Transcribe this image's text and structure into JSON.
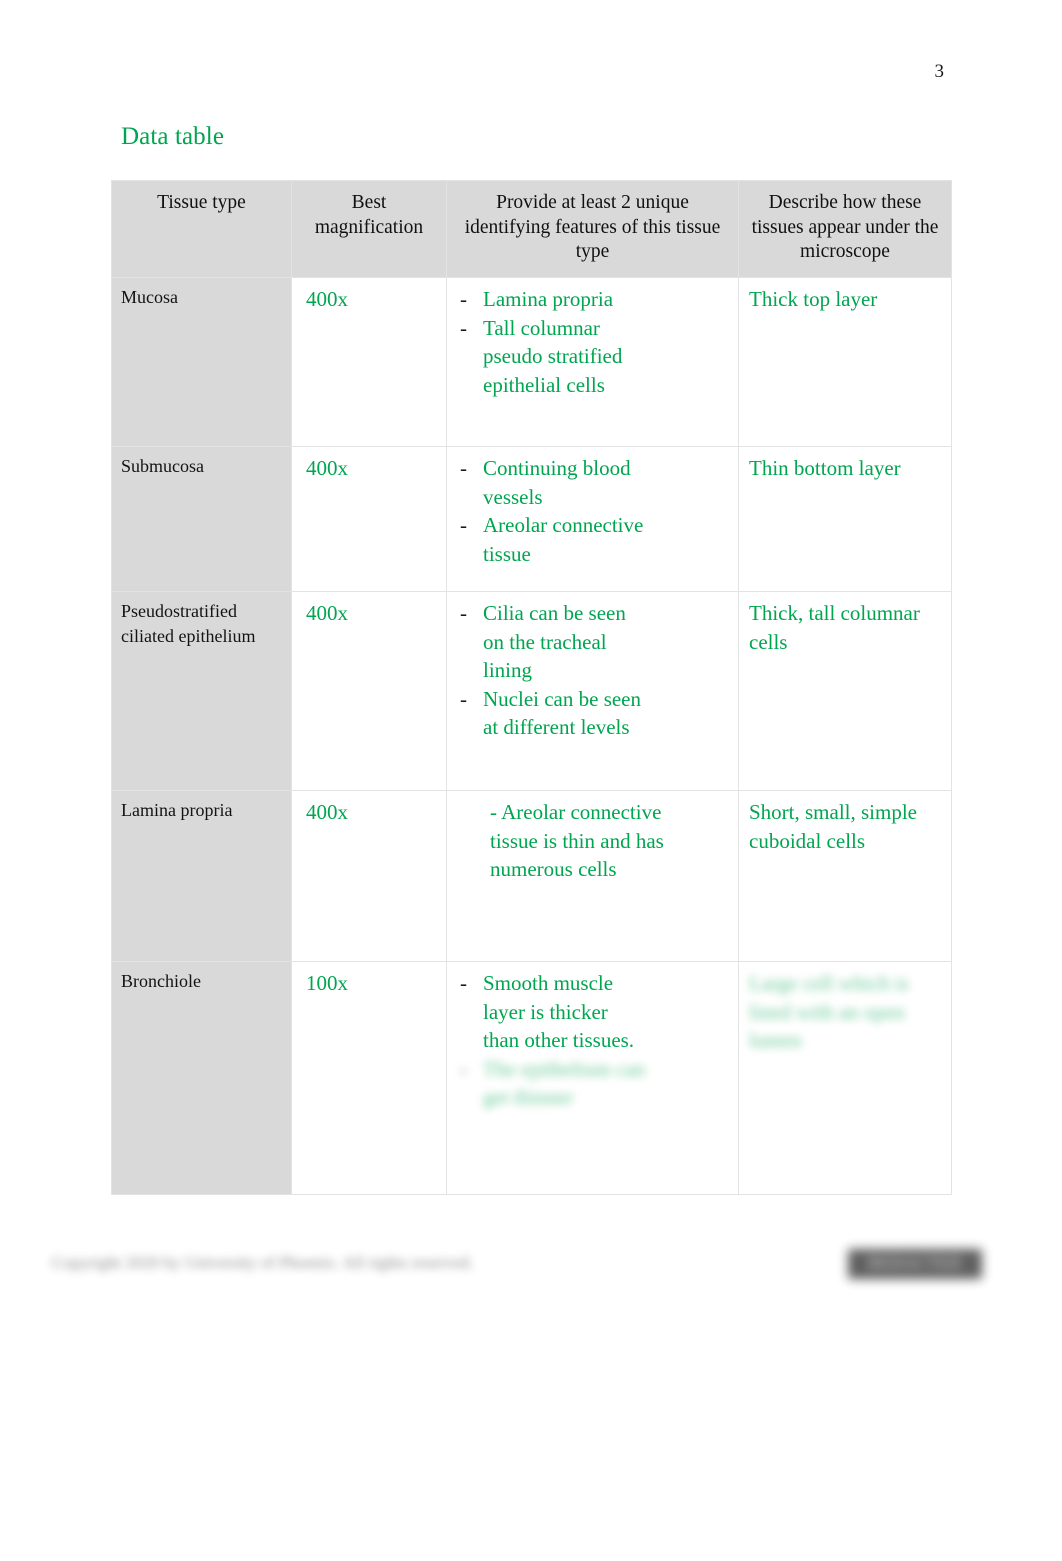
{
  "document": {
    "page_number": "3",
    "heading": "Data table",
    "accent_color": "#00a550",
    "header_fill": "#d9d9d9",
    "first_column_fill": "#d9d9d9"
  },
  "table": {
    "headers": [
      "Tissue type",
      "Best magnification",
      "Provide at least 2 unique identifying features of this tissue type",
      "Describe how these tissues appear under the microscope"
    ],
    "rows": [
      {
        "tissue": "Mucosa",
        "magnification": "400x",
        "features_style": "bullets",
        "features": [
          "Lamina propria",
          "Tall columnar pseudo stratified epithelial cells"
        ],
        "features_blurred": [],
        "describe": "Thick top layer",
        "describe_blurred": []
      },
      {
        "tissue": "Submucosa",
        "magnification": "400x",
        "features_style": "bullets",
        "features": [
          "Continuing blood vessels",
          "Areolar connective tissue"
        ],
        "features_blurred": [],
        "describe": "Thin bottom layer",
        "describe_blurred": []
      },
      {
        "tissue": "Pseudostratified ciliated epithelium",
        "magnification": "400x",
        "features_style": "bullets",
        "features": [
          "Cilia can be seen on the tracheal lining",
          "Nuclei can be seen at different levels"
        ],
        "features_blurred": [],
        "describe": "Thick, tall columnar cells",
        "describe_blurred": []
      },
      {
        "tissue": "Lamina propria",
        "magnification": "400x",
        "features_style": "plain",
        "features": [
          "- Areolar connective tissue is thin and has numerous cells"
        ],
        "features_blurred": [],
        "describe": "Short, small, simple cuboidal cells",
        "describe_blurred": []
      },
      {
        "tissue": "Bronchiole",
        "magnification": "100x",
        "features_style": "bullets",
        "features": [
          "  Smooth muscle layer is thicker than other tissues."
        ],
        "features_blurred": [
          "The epithelium can get thinner"
        ],
        "describe": "",
        "describe_blurred": [
          "Large cell which is lined with an open lumen"
        ]
      }
    ]
  },
  "footer": {
    "text": "Copyright 2020 by University of Phoenix. All rights reserved.",
    "badge": "REDACTED"
  }
}
